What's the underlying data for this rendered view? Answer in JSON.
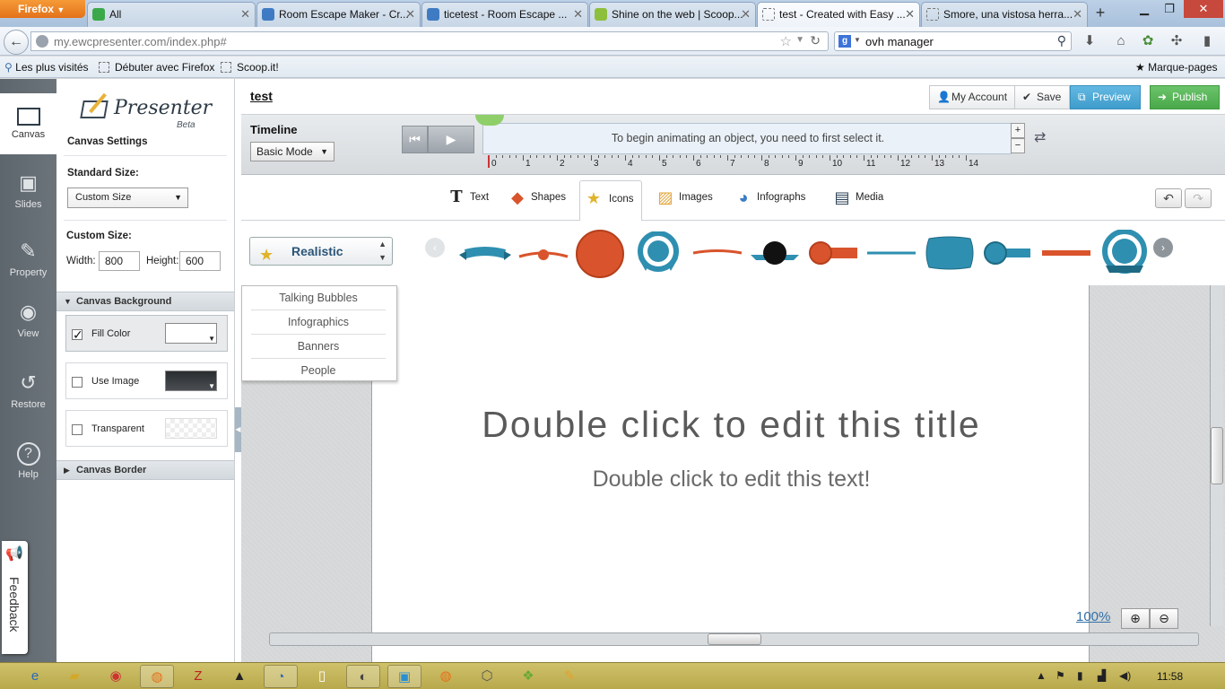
{
  "browser": {
    "menu_button": "Firefox",
    "tabs": [
      {
        "title": "All"
      },
      {
        "title": "Room Escape Maker - Cr..."
      },
      {
        "title": "ticetest - Room Escape ..."
      },
      {
        "title": "Shine on the web | Scoop..."
      },
      {
        "title": "test - Created with Easy ..."
      },
      {
        "title": "Smore, una vistosa herra..."
      }
    ],
    "new_tab": "+",
    "url_host": "my.ewcpresenter.com",
    "url_path": "/index.php#",
    "search_value": "ovh manager",
    "bookmarks": [
      "Les plus visités",
      "Débuter avec Firefox",
      "Scoop.it!"
    ],
    "bookmarks_menu": "Marque-pages"
  },
  "rail": {
    "items": [
      {
        "label": "Canvas",
        "icon": "canvas-icon"
      },
      {
        "label": "Slides",
        "icon": "slides-icon"
      },
      {
        "label": "Property",
        "icon": "property-icon"
      },
      {
        "label": "View",
        "icon": "eye-icon"
      },
      {
        "label": "Restore",
        "icon": "restore-icon"
      },
      {
        "label": "Help",
        "icon": "help-icon"
      }
    ],
    "feedback": "Feedback"
  },
  "logo": {
    "name": "Presenter",
    "tag": "Beta"
  },
  "settings": {
    "title": "Canvas Settings",
    "standard_size_label": "Standard Size:",
    "standard_size_value": "Custom Size",
    "custom_size_label": "Custom Size:",
    "width_label": "Width:",
    "width_value": "800",
    "height_label": "Height:",
    "height_value": "600",
    "background_header": "Canvas Background",
    "fill_color_label": "Fill Color",
    "use_image_label": "Use Image",
    "transparent_label": "Transparent",
    "border_header": "Canvas Border",
    "fill_color": "#ffffff"
  },
  "topbar": {
    "doc_title": "test",
    "my_account": "My Account",
    "save": "Save",
    "preview": "Preview",
    "publish": "Publish"
  },
  "timeline": {
    "title": "Timeline",
    "mode": "Basic Mode",
    "message": "To begin animating an object, you need to first select it.",
    "ticks": [
      "0",
      "1",
      "2",
      "3",
      "4",
      "5",
      "6",
      "7",
      "8",
      "9",
      "10",
      "11",
      "12",
      "13",
      "14"
    ],
    "zoom_in": "+",
    "zoom_out": "−"
  },
  "tools": [
    {
      "label": "Text",
      "icon": "text-tool-icon"
    },
    {
      "label": "Shapes",
      "icon": "shapes-tool-icon"
    },
    {
      "label": "Icons",
      "icon": "icons-tool-icon"
    },
    {
      "label": "Images",
      "icon": "images-tool-icon"
    },
    {
      "label": "Infographs",
      "icon": "infographs-tool-icon"
    },
    {
      "label": "Media",
      "icon": "media-tool-icon"
    }
  ],
  "icons_panel": {
    "category": "Realistic",
    "categories": [
      "Talking Bubbles",
      "Infographics",
      "Banners",
      "People"
    ]
  },
  "canvas": {
    "title": "Double click to edit this title",
    "text": "Double click to edit this text!",
    "zoom": "100%"
  },
  "taskbar": {
    "clock": "11:58"
  },
  "colors": {
    "accent_blue": "#3f9ccb",
    "publish_green": "#4aa84a",
    "sticker_teal": "#2f8fb0",
    "sticker_orange": "#d9542c"
  }
}
